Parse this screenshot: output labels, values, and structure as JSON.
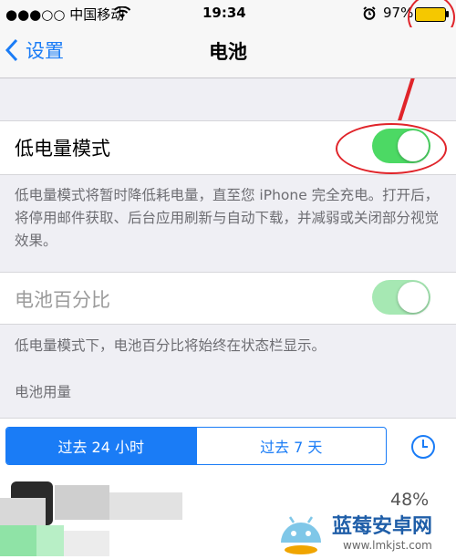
{
  "status": {
    "carrier": "●●●○○ 中国移动",
    "time": "19:34",
    "battery": "97%"
  },
  "nav": {
    "back_label": "设置",
    "title": "电池"
  },
  "low_power": {
    "label": "低电量模式",
    "on": true,
    "note": "低电量模式将暂时降低耗电量，直至您 iPhone 完全充电。打开后，将停用邮件获取、后台应用刷新与自动下载，并减弱或关闭部分视觉效果。"
  },
  "percent_row": {
    "label": "电池百分比",
    "on": true,
    "note": "低电量模式下，电池百分比将始终在状态栏显示。"
  },
  "usage": {
    "header": "电池用量",
    "segments": [
      "过去 24 小时",
      "过去 7 天"
    ],
    "selected": 0,
    "first_app_percent": "48%"
  },
  "watermark": {
    "name": "蓝莓安卓网",
    "url": "www.lmkjst.com"
  },
  "colors": {
    "accent": "#1a7cf6",
    "toggle_on": "#4cd964",
    "annotation": "#e0242a"
  }
}
